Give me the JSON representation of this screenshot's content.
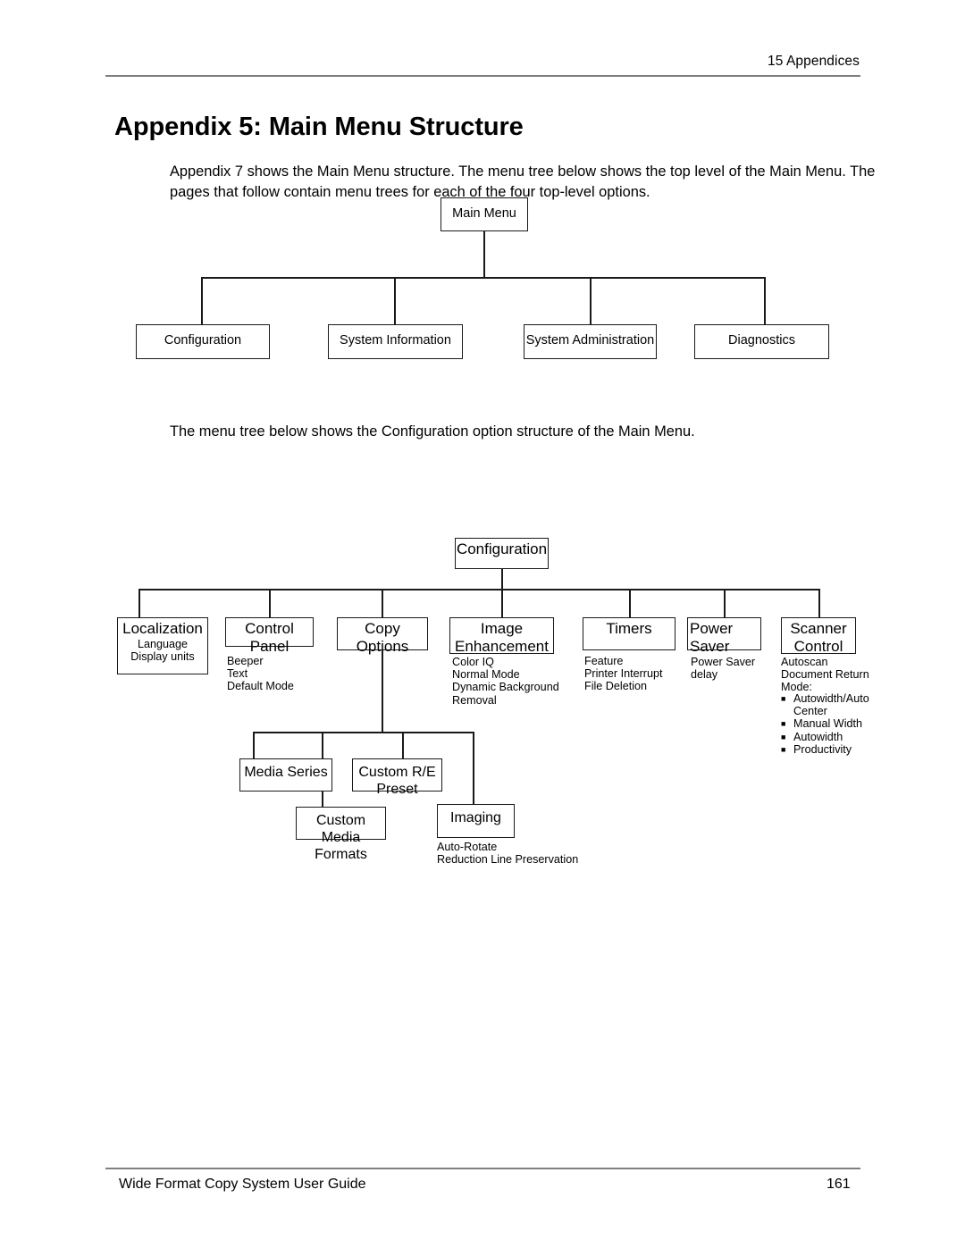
{
  "header": {
    "right_text": "15 Appendices"
  },
  "footer": {
    "left_text": "Wide Format Copy System User Guide",
    "page_number": "161"
  },
  "page_title": "Appendix 5:  Main Menu Structure",
  "paragraphs": {
    "intro": "Appendix 7 shows the Main Menu structure.  The menu tree below shows the top level of the Main Menu.  The pages that follow contain menu trees for each of the four top-level options.",
    "config_intro": "The menu tree below shows the Configuration option structure of the Main Menu."
  },
  "diagram_main_menu": {
    "root": "Main Menu",
    "children": [
      "Configuration",
      "System Information",
      "System Administration",
      "Diagnostics"
    ]
  },
  "diagram_configuration": {
    "root": "Configuration",
    "nodes": {
      "localization": {
        "label": "Localization",
        "items": "Language\nDisplay units"
      },
      "control_panel": {
        "label": "Control Panel",
        "items": "Beeper\nText\nDefault Mode"
      },
      "copy_options": {
        "label": "Copy Options"
      },
      "image_enhancement": {
        "label": "Image\nEnhancement",
        "items": "Color IQ\nNormal Mode\nDynamic Background\n  Removal"
      },
      "timers": {
        "label": "Timers",
        "items": "Feature\nPrinter Interrupt\nFile Deletion"
      },
      "power_saver": {
        "label": "Power\nSaver",
        "items": "Power Saver\ndelay"
      },
      "scanner_control": {
        "label": "Scanner\nControl",
        "items": "Autoscan\nDocument Return\nMode:",
        "bullets": [
          "Autowidth/Auto\nCenter",
          "Manual Width",
          "Autowidth",
          "Productivity"
        ]
      },
      "media_series": {
        "label": "Media Series"
      },
      "custom_re_preset": {
        "label": "Custom R/E\nPreset"
      },
      "custom_media_formats": {
        "label": "Custom Media\nFormats"
      },
      "imaging": {
        "label": "Imaging",
        "items": "Auto-Rotate\nReduction Line Preservation"
      }
    }
  }
}
